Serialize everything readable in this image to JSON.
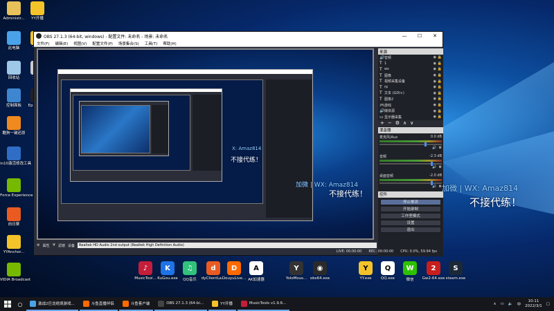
{
  "desktop_icons": [
    {
      "label": "Administr...",
      "icon": "user-folder-icon",
      "color": "#e8c15a"
    },
    {
      "label": "YY开播",
      "icon": "yy-icon",
      "color": "#f3c329"
    },
    {
      "label": "此电脑",
      "icon": "computer-icon",
      "color": "#4aa3e8"
    },
    {
      "label": "YY20",
      "icon": "yy-icon",
      "color": "#f3c329"
    },
    {
      "label": "回收站",
      "icon": "recycle-bin-icon",
      "color": "#9ec7e8"
    },
    {
      "label": "3e53",
      "icon": "file-icon",
      "color": "#cccccc"
    },
    {
      "label": "控制面板",
      "icon": "control-panel-icon",
      "color": "#3e86d0"
    },
    {
      "label": "Epic Laun",
      "icon": "epic-icon",
      "color": "#222222"
    },
    {
      "label": "酷狗一键还原",
      "icon": "backup-icon",
      "color": "#f08a1e"
    },
    {
      "label": "Win10激活修改工具",
      "icon": "win-tool-icon",
      "color": "#2f6ec4"
    },
    {
      "label": "GeForce Experience",
      "icon": "nvidia-icon",
      "color": "#76b900"
    },
    {
      "label": "向日葵",
      "icon": "sunflower-icon",
      "color": "#ea5b22"
    },
    {
      "label": "YYAnchor...",
      "icon": "yy-icon",
      "color": "#f3c329"
    },
    {
      "label": "NVIDIA Broadcast",
      "icon": "nvidia-icon",
      "color": "#76b900"
    }
  ],
  "obs": {
    "title": "OBS 27.1.3 (64-bit, windows) - 配置文件: 未命名 - 场景: 未命名",
    "menu": [
      "文件(F)",
      "编辑(E)",
      "视图(V)",
      "配置文件(P)",
      "场景集合(S)",
      "工具(T)",
      "帮助(H)"
    ],
    "sources_header": "来源",
    "sources": [
      {
        "name": "音频",
        "icon": "speaker-icon"
      },
      {
        "name": "1",
        "icon": "text-icon"
      },
      {
        "name": "ws",
        "icon": "text-icon"
      },
      {
        "name": "图像",
        "icon": "text-icon"
      },
      {
        "name": "视频采集设备",
        "icon": "text-icon"
      },
      {
        "name": "rp",
        "icon": "text-icon"
      },
      {
        "name": "文本 (GDI+)",
        "icon": "text-icon"
      },
      {
        "name": "图像2",
        "icon": "text-icon"
      },
      {
        "name": "游戏",
        "icon": "gamepad-icon"
      },
      {
        "name": "媒体源",
        "icon": "speaker-icon"
      },
      {
        "name": "显示器采集",
        "icon": "monitor-icon"
      }
    ],
    "toolbar": [
      "+",
      "−",
      "⚙",
      "∧",
      "∨"
    ],
    "mixer_header": "混音器",
    "mixer": [
      {
        "name": "麦克风/Aux",
        "db": "0.0 dB",
        "level": 0.72
      },
      {
        "name": "音频",
        "db": "-2.3 dB",
        "level": 0.82
      },
      {
        "name": "桌面音频",
        "db": "-2.0 dB",
        "level": 0.82
      }
    ],
    "controls_header": "控件",
    "controls": [
      "停止推流",
      "开始录制",
      "工作室模式",
      "设置",
      "退出"
    ],
    "bottom": {
      "props": "属性",
      "filters": "滤镜",
      "device_label": "设备",
      "device_value": "Realtek HD Audio 2nd output (Realtek High Definition Audio)"
    },
    "status": {
      "live": "LIVE: 00:00:00",
      "rec": "REC: 00:00:00",
      "cpu": "CPU: 0.0%, 59.94 fps"
    }
  },
  "overlay": {
    "wx": "加微 | WX: Amaz814",
    "slogan": "不接代练！",
    "wx_small": "X: Amaz814",
    "slogan_small": "不接代练！"
  },
  "apps": [
    {
      "label": "MusicTool...",
      "color": "#c41e3a",
      "glyph": "♪"
    },
    {
      "label": "KuGou.exe",
      "color": "#1e73e8",
      "glyph": "K"
    },
    {
      "label": "QQ音乐",
      "color": "#31c27c",
      "glyph": "♫"
    },
    {
      "label": "dyClientLa...",
      "color": "#ea5b22",
      "glyph": "d"
    },
    {
      "label": "DouyuLive...",
      "color": "#ff6a00",
      "glyph": "D"
    },
    {
      "label": "AK加速器",
      "color": "#ffffff",
      "glyph": "A"
    },
    {
      "label": "YoloMous...",
      "color": "#333333",
      "glyph": "Y"
    },
    {
      "label": "obs64.exe",
      "color": "#2a2a2a",
      "glyph": "◉"
    },
    {
      "label": "YY.exe",
      "color": "#f3c329",
      "glyph": "Y"
    },
    {
      "label": "QQ.exe",
      "color": "#ffffff",
      "glyph": "Q"
    },
    {
      "label": "微信",
      "color": "#2dc100",
      "glyph": "W"
    },
    {
      "label": "Gw2-64.exe",
      "color": "#c81e1e",
      "glyph": "2"
    },
    {
      "label": "steam.exe",
      "color": "#1b2838",
      "glyph": "S"
    }
  ],
  "taskbar": {
    "items": [
      {
        "label": "激战2巨龙绝境游戏...",
        "color": "#4aa3e8"
      },
      {
        "label": "斗鱼直播伴侣",
        "color": "#ff6a00"
      },
      {
        "label": "斗鱼客户端",
        "color": "#ff6a00"
      },
      {
        "label": "OBS 27.1.3 (64-bi...",
        "color": "#444444"
      },
      {
        "label": "YY开播",
        "color": "#f3c329"
      },
      {
        "label": "MusicTools v1.9.6...",
        "color": "#c41e3a"
      }
    ],
    "time": "10:11",
    "date": "2022/3/1"
  }
}
